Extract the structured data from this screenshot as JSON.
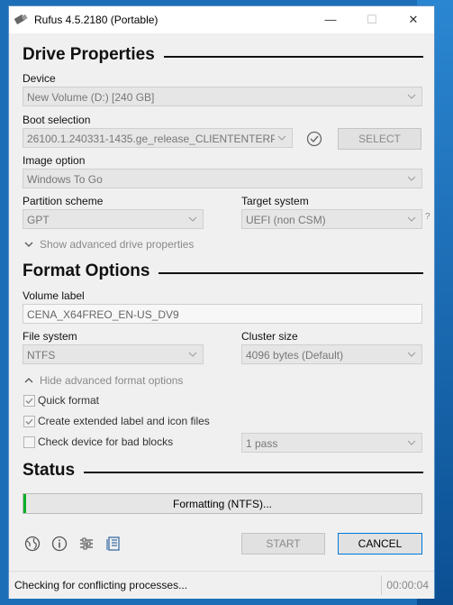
{
  "window": {
    "title": "Rufus 4.5.2180 (Portable)",
    "min": "—",
    "max": "☐",
    "close": "✕"
  },
  "drive": {
    "heading": "Drive Properties",
    "device_label": "Device",
    "device_value": "New Volume (D:) [240 GB]",
    "boot_label": "Boot selection",
    "boot_value": "26100.1.240331-1435.ge_release_CLIENTENTERPRISE_",
    "select_button": "SELECT",
    "image_option_label": "Image option",
    "image_option_value": "Windows To Go",
    "partition_label": "Partition scheme",
    "partition_value": "GPT",
    "target_label": "Target system",
    "target_value": "UEFI (non CSM)",
    "target_help": "?",
    "advanced_toggle": "Show advanced drive properties"
  },
  "format": {
    "heading": "Format Options",
    "volume_label": "Volume label",
    "volume_value": "CENA_X64FREO_EN-US_DV9",
    "fs_label": "File system",
    "fs_value": "NTFS",
    "cluster_label": "Cluster size",
    "cluster_value": "4096 bytes (Default)",
    "advanced_toggle": "Hide advanced format options",
    "quick_format": "Quick format",
    "quick_format_checked": true,
    "extended_label": "Create extended label and icon files",
    "extended_checked": true,
    "bad_blocks": "Check device for bad blocks",
    "bad_blocks_checked": false,
    "passes_value": "1 pass"
  },
  "status": {
    "heading": "Status",
    "progress_text": "Formatting (NTFS)...",
    "progress_fraction": 0.005
  },
  "actions": {
    "start": "START",
    "cancel": "CANCEL"
  },
  "statusbar": {
    "message": "Checking for conflicting processes...",
    "timer": "00:00:04"
  }
}
